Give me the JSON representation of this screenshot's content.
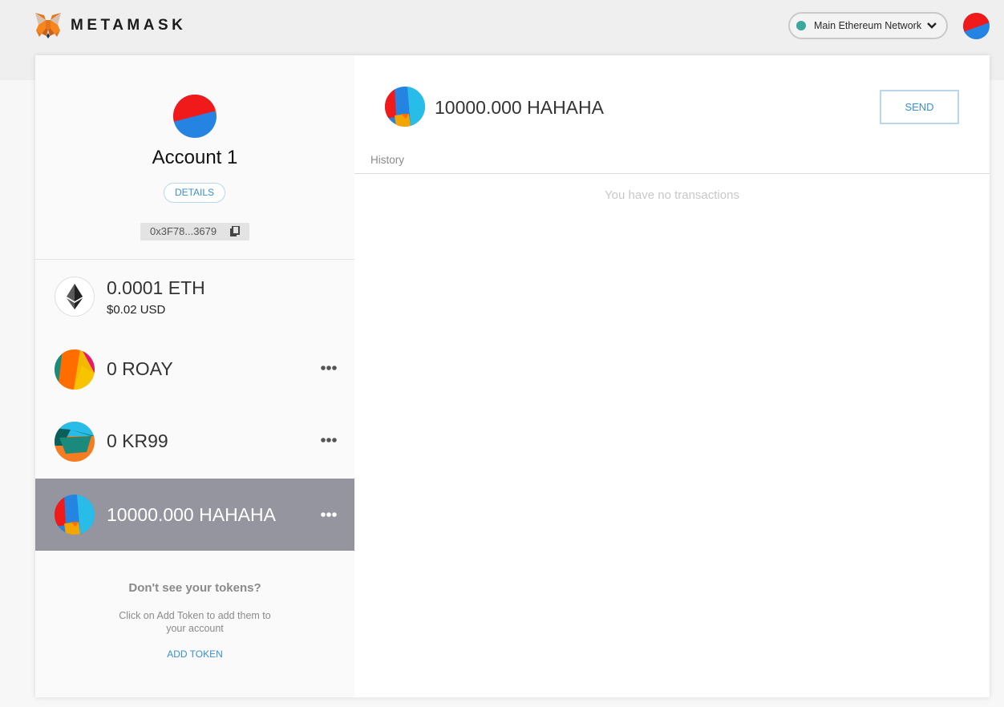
{
  "header": {
    "brand": "METAMASK",
    "network": {
      "label": "Main Ethereum Network",
      "status_color": "#38a99c"
    }
  },
  "account": {
    "name": "Account 1",
    "details_label": "DETAILS",
    "address": "0x3F78...3679"
  },
  "tokens": [
    {
      "amount": "0.0001 ETH",
      "usd": "$0.02 USD",
      "icon": "ethereum-icon"
    },
    {
      "amount": "0 ROAY",
      "icon": "roay-identicon"
    },
    {
      "amount": "0 KR99",
      "icon": "kr99-identicon"
    },
    {
      "amount": "10000.000 HAHAHA",
      "icon": "hahaha-identicon",
      "selected": true
    }
  ],
  "missing_tokens": {
    "title": "Don't see your tokens?",
    "description": "Click on Add Token to add them to your account",
    "add_label": "ADD TOKEN"
  },
  "main": {
    "balance": "10000.000 HAHAHA",
    "send_label": "SEND",
    "history_label": "History",
    "empty_message": "You have no transactions"
  },
  "colors": {
    "accent": "#3a8fd0",
    "selected_row": "#95959f"
  }
}
